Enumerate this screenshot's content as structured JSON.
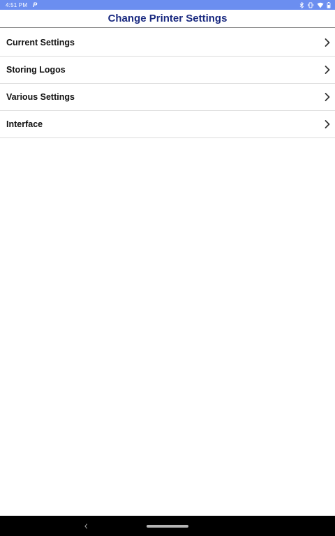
{
  "status_bar": {
    "time": "4:51 PM",
    "app_indicator": "P",
    "icons": [
      "bluetooth-icon",
      "vibrate-icon",
      "wifi-icon",
      "battery-icon"
    ],
    "background_color": "#6b8ef0"
  },
  "header": {
    "title": "Change Printer Settings",
    "title_color": "#1a2a80"
  },
  "menu": {
    "items": [
      {
        "label": "Current Settings",
        "icon": "chevron-right-icon"
      },
      {
        "label": "Storing Logos",
        "icon": "chevron-right-icon"
      },
      {
        "label": "Various Settings",
        "icon": "chevron-right-icon"
      },
      {
        "label": "Interface",
        "icon": "chevron-right-icon"
      }
    ]
  },
  "nav_bar": {
    "icons": [
      "back-icon",
      "home-handle"
    ]
  }
}
